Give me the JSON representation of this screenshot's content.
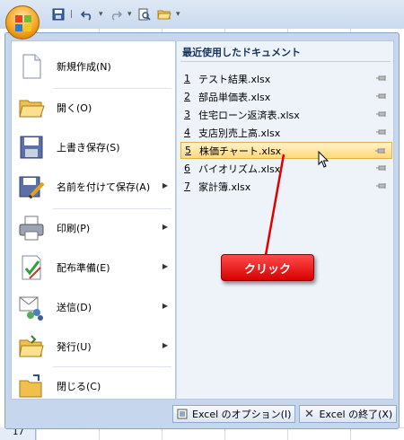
{
  "qat": {
    "icons": [
      "office-orb",
      "save-icon",
      "undo-icon",
      "redo-icon",
      "print-preview-icon",
      "open-icon",
      "customize-icon"
    ]
  },
  "menu": {
    "items": [
      {
        "label": "新規作成(N)",
        "icon": "new-document-icon",
        "has_submenu": false
      },
      {
        "label": "開く(O)",
        "icon": "open-folder-icon",
        "has_submenu": false
      },
      {
        "label": "上書き保存(S)",
        "icon": "save-disk-icon",
        "has_submenu": false
      },
      {
        "label": "名前を付けて保存(A)",
        "icon": "save-as-icon",
        "has_submenu": true
      },
      {
        "label": "印刷(P)",
        "icon": "printer-icon",
        "has_submenu": true
      },
      {
        "label": "配布準備(E)",
        "icon": "prepare-icon",
        "has_submenu": true
      },
      {
        "label": "送信(D)",
        "icon": "send-icon",
        "has_submenu": true
      },
      {
        "label": "発行(U)",
        "icon": "publish-icon",
        "has_submenu": true
      },
      {
        "label": "閉じる(C)",
        "icon": "close-folder-icon",
        "has_submenu": false
      }
    ]
  },
  "recent": {
    "title": "最近使用したドキュメント",
    "items": [
      {
        "num": "1",
        "name": "テスト結果.xlsx",
        "highlight": false
      },
      {
        "num": "2",
        "name": "部品単価表.xlsx",
        "highlight": false
      },
      {
        "num": "3",
        "name": "住宅ローン返済表.xlsx",
        "highlight": false
      },
      {
        "num": "4",
        "name": "支店別売上高.xlsx",
        "highlight": false
      },
      {
        "num": "5",
        "name": "株価チャート.xlsx",
        "highlight": true
      },
      {
        "num": "6",
        "name": "バイオリズム.xlsx",
        "highlight": false
      },
      {
        "num": "7",
        "name": "家計簿.xlsx",
        "highlight": false
      }
    ]
  },
  "buttons": {
    "options": "Excel のオプション(I)",
    "exit": "Excel の終了(X)"
  },
  "annotation": {
    "label": "クリック",
    "color": "#e00000"
  },
  "sheet": {
    "row_number": "17"
  }
}
